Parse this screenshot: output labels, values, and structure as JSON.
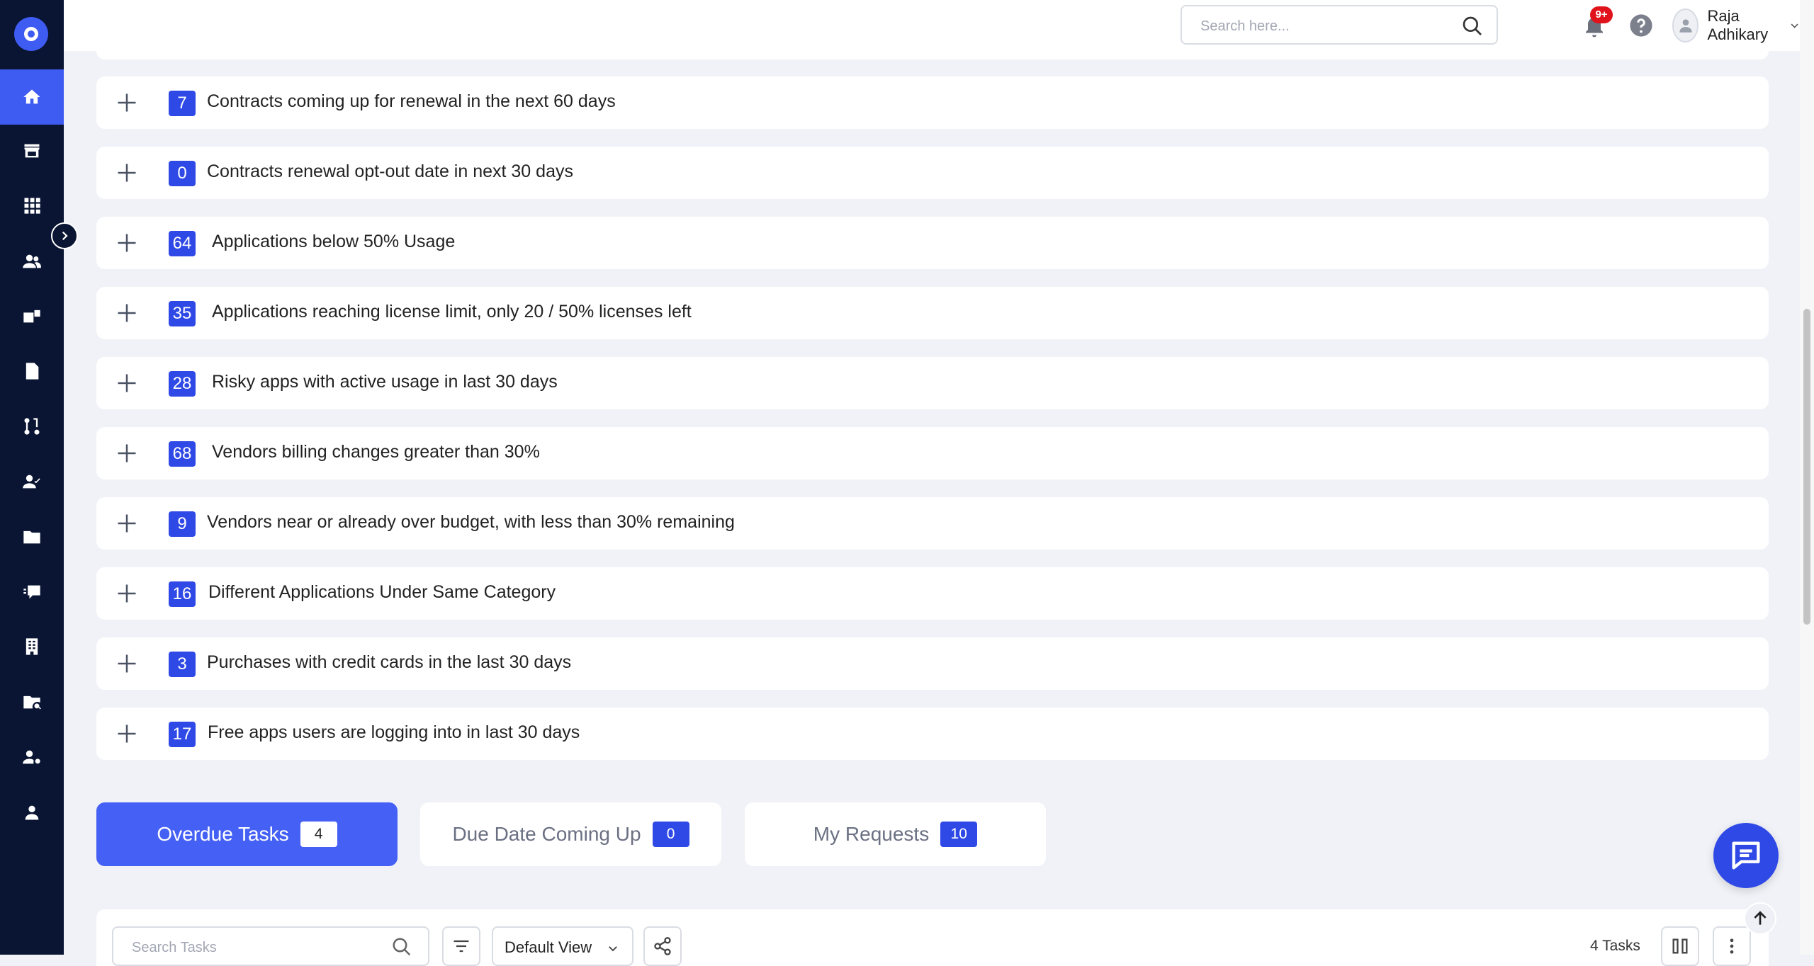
{
  "header": {
    "search_placeholder": "Search here...",
    "notification_badge": "9+",
    "user_name": "Raja Adhikary"
  },
  "sidebar": {
    "items": [
      {
        "icon": "home-icon",
        "active": true
      },
      {
        "icon": "store-icon",
        "active": false
      },
      {
        "icon": "apps-grid-icon",
        "active": false
      },
      {
        "icon": "users-icon",
        "active": false
      },
      {
        "icon": "vendors-icon",
        "active": false
      },
      {
        "icon": "document-icon",
        "active": false
      },
      {
        "icon": "workflow-icon",
        "active": false
      },
      {
        "icon": "user-check-icon",
        "active": false
      },
      {
        "icon": "folder-icon",
        "active": false
      },
      {
        "icon": "feedback-icon",
        "active": false
      },
      {
        "icon": "building-icon",
        "active": false
      },
      {
        "icon": "folder-search-icon",
        "active": false
      },
      {
        "icon": "user-settings-icon",
        "active": false
      },
      {
        "icon": "profile-icon",
        "active": false
      }
    ]
  },
  "insights": [
    {
      "count": "7",
      "label": "Contracts coming up for renewal in the next 60 days"
    },
    {
      "count": "0",
      "label": "Contracts renewal opt-out date in next 30 days"
    },
    {
      "count": "64",
      "label": "Applications below 50% Usage"
    },
    {
      "count": "35",
      "label": "Applications reaching license limit, only 20 / 50% licenses left"
    },
    {
      "count": "28",
      "label": "Risky apps with active usage in last 30 days"
    },
    {
      "count": "68",
      "label": "Vendors billing changes greater than 30%"
    },
    {
      "count": "9",
      "label": "Vendors near or already over budget, with less than 30% remaining"
    },
    {
      "count": "16",
      "label": "Different Applications Under Same Category"
    },
    {
      "count": "3",
      "label": "Purchases with credit cards in the last 30 days"
    },
    {
      "count": "17",
      "label": "Free apps users are logging into in last 30 days"
    }
  ],
  "tabs": [
    {
      "label": "Overdue Tasks",
      "count": "4",
      "active": true
    },
    {
      "label": "Due Date Coming Up",
      "count": "0",
      "active": false
    },
    {
      "label": "My Requests",
      "count": "10",
      "active": false
    }
  ],
  "tasks": {
    "search_placeholder": "Search Tasks",
    "view": "Default View",
    "count_label": "4 Tasks"
  },
  "colors": {
    "sidebar_bg": "#0a1533",
    "accent": "#3e5bf2",
    "badge": "#2f49e6",
    "page_bg": "#f0f2f7"
  }
}
